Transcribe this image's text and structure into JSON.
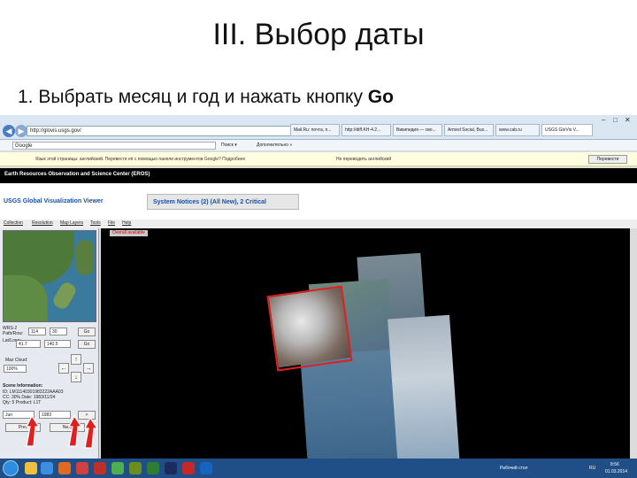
{
  "slide": {
    "title": "III. Выбор даты",
    "subtitle_prefix": "1. Выбрать месяц и год и нажать кнопку ",
    "subtitle_button": "Go"
  },
  "browser": {
    "address": "http://glovis.usgs.gov/",
    "tabs": [
      "Mail.Ru: почта, п...",
      "http://diff.KH-4.2...",
      "Википедия — сво...",
      "Armed Social, Bus...",
      "www.cab.ru",
      "USGS GloVis V..."
    ],
    "search_label": "Google",
    "menu_items": [
      "Поиск ▾",
      "Дополнительно »"
    ],
    "translate_text": "Язык этой страницы: английский. Перевести её с помощью панели инструментов Google? Подробнее",
    "translate_options": "Не переводить английский",
    "translate_button": "Перевести"
  },
  "header": {
    "org": "Earth Resources Observation and Science Center (EROS)",
    "app_title": "USGS Global Visualization Viewer",
    "notices": "System Notices (2) (All New), 2 Critical"
  },
  "app_menu": [
    "Collection",
    "Resolution",
    "Map Layers",
    "Tools",
    "File",
    "Help"
  ],
  "controls": {
    "wrs_label": "WRS-2 Path/Row:",
    "path": "114",
    "row": "30",
    "go1": "Go",
    "lat_label": "Lat/Long:",
    "lat": "41.7",
    "lon": "140.5",
    "go2": "Go",
    "max_cloud_label": "Max Cloud:",
    "max_cloud": "100%",
    "scene_info_label": "Scene Information:",
    "scene_lines": [
      "ID: LM11140301983222AAA03",
      "CC: 30%   Date: 1983/11/24",
      "Qty: 5   Product: L1T"
    ],
    "month": "Jun",
    "year": "1983",
    "prev_button": "Prev",
    "next_button": "Next"
  },
  "map": {
    "status": "Overall available"
  },
  "taskbar": {
    "lang": "RU",
    "time": "8:56",
    "date": "01.03.2014",
    "tray_text": "Рабочий стол"
  },
  "colors": {
    "selection": "#e02020",
    "arrow": "#e02020",
    "taskbar": "#1f4f86",
    "link": "#1b4f9c"
  }
}
